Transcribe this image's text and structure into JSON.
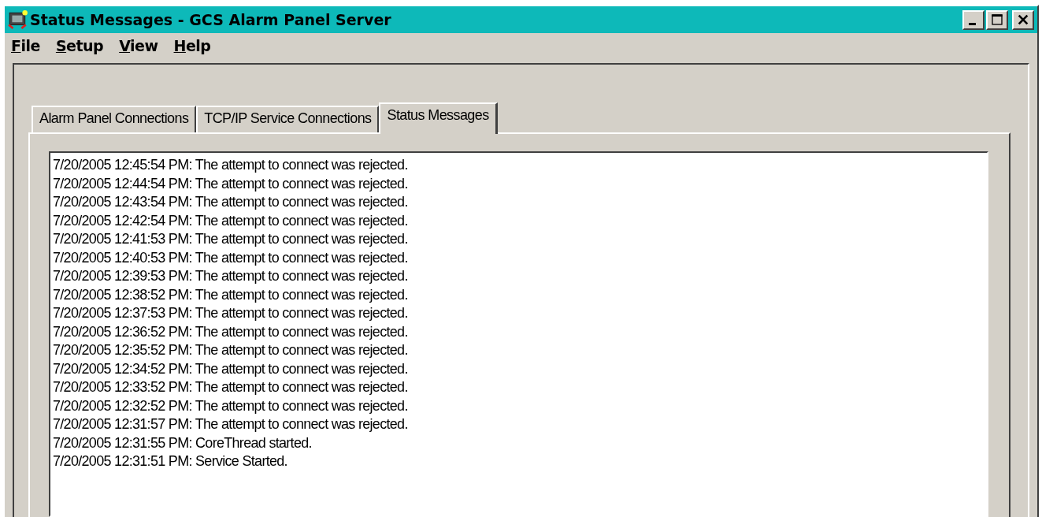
{
  "window": {
    "title": "Status Messages - GCS Alarm Panel Server"
  },
  "menu": [
    "File",
    "Setup",
    "View",
    "Help"
  ],
  "tabs": [
    {
      "label": "Alarm Panel Connections",
      "selected": false
    },
    {
      "label": "TCP/IP Service Connections",
      "selected": false
    },
    {
      "label": "Status Messages",
      "selected": true
    }
  ],
  "messages": [
    "7/20/2005 12:45:54 PM: The attempt to connect was rejected.",
    "7/20/2005 12:44:54 PM: The attempt to connect was rejected.",
    "7/20/2005 12:43:54 PM: The attempt to connect was rejected.",
    "7/20/2005 12:42:54 PM: The attempt to connect was rejected.",
    "7/20/2005 12:41:53 PM: The attempt to connect was rejected.",
    "7/20/2005 12:40:53 PM: The attempt to connect was rejected.",
    "7/20/2005 12:39:53 PM: The attempt to connect was rejected.",
    "7/20/2005 12:38:52 PM: The attempt to connect was rejected.",
    "7/20/2005 12:37:53 PM: The attempt to connect was rejected.",
    "7/20/2005 12:36:52 PM: The attempt to connect was rejected.",
    "7/20/2005 12:35:52 PM: The attempt to connect was rejected.",
    "7/20/2005 12:34:52 PM: The attempt to connect was rejected.",
    "7/20/2005 12:33:52 PM: The attempt to connect was rejected.",
    "7/20/2005 12:32:52 PM: The attempt to connect was rejected.",
    "7/20/2005 12:31:57 PM: The attempt to connect was rejected.",
    "7/20/2005 12:31:55 PM: CoreThread started.",
    "7/20/2005 12:31:51 PM: Service Started."
  ]
}
